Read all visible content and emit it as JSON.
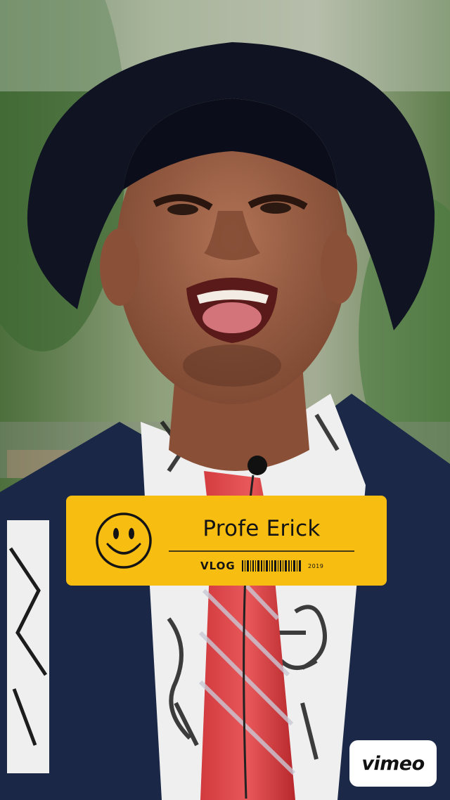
{
  "video": {
    "description_icon": "video-frame"
  },
  "lower_third": {
    "name": "Profe Erick",
    "tag": "VLOG",
    "year": "2019",
    "icon": "smiley-icon",
    "color": "#f7bd10"
  },
  "badge": {
    "label": "vimeo",
    "icon": "vimeo-logo"
  }
}
